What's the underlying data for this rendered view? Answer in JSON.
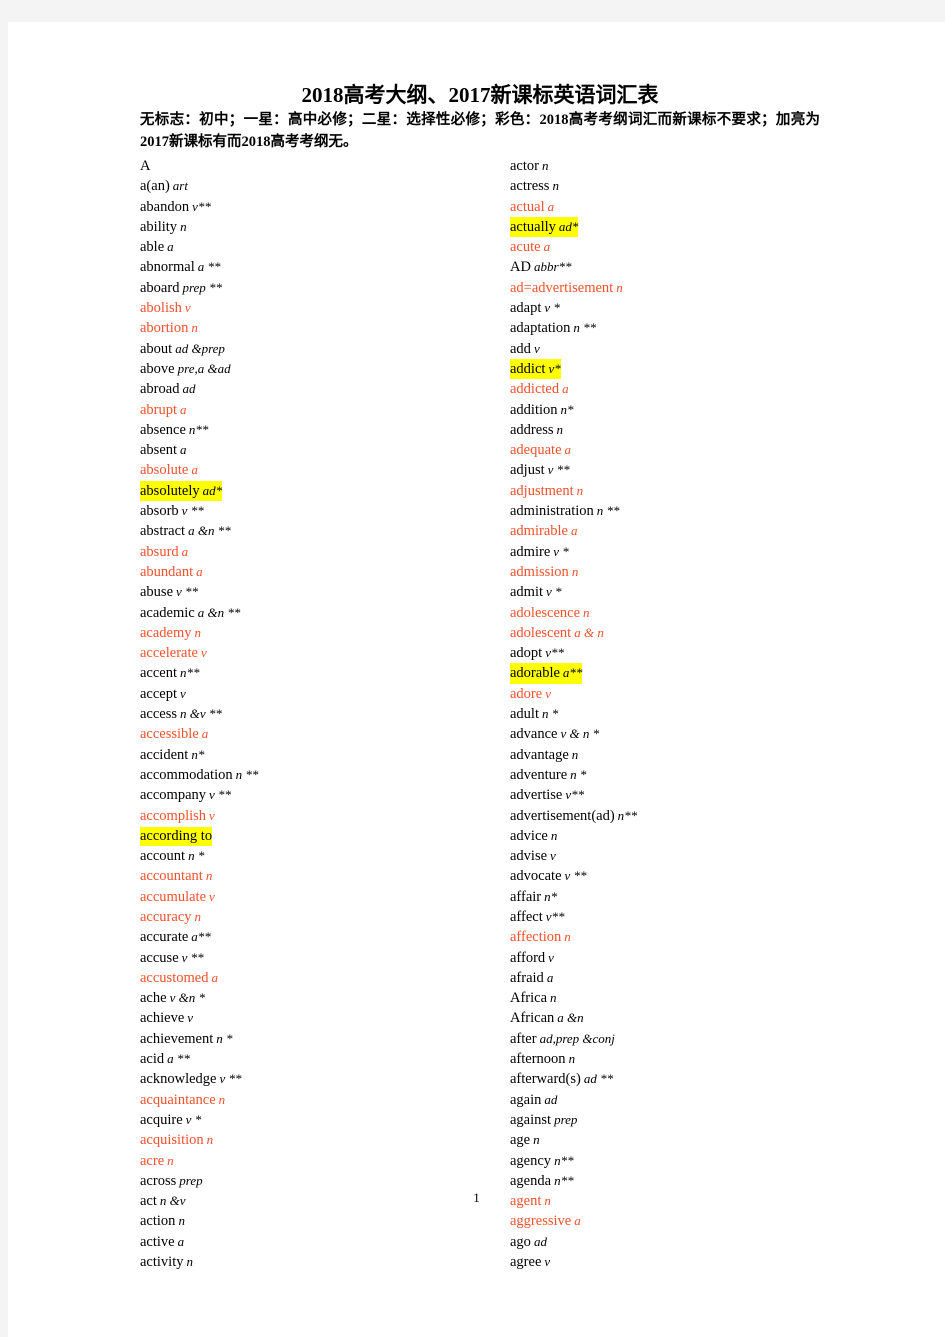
{
  "document": {
    "title": "2018高考大纲、2017新课标英语词汇表",
    "subtitle": "无标志：初中；一星：高中必修；二星：选择性必修；彩色：2018高考考纲词汇而新课标不要求；加亮为2017新课标有而2018高考考纲无。",
    "page_number": "1",
    "colors": {
      "red_entry": "#f4512c",
      "highlight": "#ffff00",
      "text": "#000000",
      "page_background": "#ffffff",
      "canvas_background": "#f4f4f4"
    }
  },
  "legend": {
    "no_mark": "初中",
    "one_star": "高中必修",
    "two_star": "选择性必修",
    "colored": "2018高考考纲词汇而新课标不要求",
    "highlighted": "2017新课标有而2018高考考纲无"
  },
  "columns": [
    {
      "id": "left",
      "entries": [
        {
          "word": "A",
          "pos": "",
          "style": "plain"
        },
        {
          "word": "a(an)",
          "pos": "art",
          "style": "plain"
        },
        {
          "word": "abandon",
          "pos": "v**",
          "style": "plain"
        },
        {
          "word": "ability",
          "pos": "n",
          "style": "plain"
        },
        {
          "word": "able",
          "pos": "a",
          "style": "plain"
        },
        {
          "word": "abnormal",
          "pos": "a **",
          "style": "plain"
        },
        {
          "word": "aboard",
          "pos": "prep **",
          "style": "plain"
        },
        {
          "word": "abolish",
          "pos": "v",
          "style": "red"
        },
        {
          "word": "abortion",
          "pos": "n",
          "style": "red"
        },
        {
          "word": "about",
          "pos": "ad &prep",
          "style": "plain"
        },
        {
          "word": "above",
          "pos": "pre,a &ad",
          "style": "plain"
        },
        {
          "word": "abroad",
          "pos": "ad",
          "style": "plain"
        },
        {
          "word": "abrupt",
          "pos": "a",
          "style": "red"
        },
        {
          "word": "absence",
          "pos": "n**",
          "style": "plain"
        },
        {
          "word": "absent",
          "pos": "a",
          "style": "plain"
        },
        {
          "word": "absolute",
          "pos": "a",
          "style": "red"
        },
        {
          "word": "absolutely",
          "pos": "ad*",
          "style": "highlight"
        },
        {
          "word": "absorb",
          "pos": "v **",
          "style": "plain"
        },
        {
          "word": "abstract",
          "pos": "a &n **",
          "style": "plain"
        },
        {
          "word": "absurd",
          "pos": "a",
          "style": "red"
        },
        {
          "word": "abundant",
          "pos": "a",
          "style": "red"
        },
        {
          "word": "abuse",
          "pos": "v **",
          "style": "plain"
        },
        {
          "word": "academic",
          "pos": "a &n **",
          "style": "plain"
        },
        {
          "word": "academy",
          "pos": "n",
          "style": "red"
        },
        {
          "word": "accelerate",
          "pos": "v",
          "style": "red"
        },
        {
          "word": "accent",
          "pos": "n**",
          "style": "plain"
        },
        {
          "word": "accept",
          "pos": "v",
          "style": "plain"
        },
        {
          "word": "access",
          "pos": "n &v **",
          "style": "plain"
        },
        {
          "word": "accessible",
          "pos": "a",
          "style": "red"
        },
        {
          "word": "accident",
          "pos": "n*",
          "style": "plain"
        },
        {
          "word": "accommodation",
          "pos": "n **",
          "style": "plain"
        },
        {
          "word": "accompany",
          "pos": "v **",
          "style": "plain"
        },
        {
          "word": "accomplish",
          "pos": "v",
          "style": "red"
        },
        {
          "word": "according to",
          "pos": "",
          "style": "highlight"
        },
        {
          "word": "account",
          "pos": "n *",
          "style": "plain"
        },
        {
          "word": "accountant",
          "pos": "n",
          "style": "red"
        },
        {
          "word": "accumulate",
          "pos": "v",
          "style": "red"
        },
        {
          "word": "accuracy",
          "pos": "n",
          "style": "red"
        },
        {
          "word": "accurate",
          "pos": "a**",
          "style": "plain"
        },
        {
          "word": "accuse",
          "pos": "v **",
          "style": "plain"
        },
        {
          "word": "accustomed",
          "pos": "a",
          "style": "red"
        },
        {
          "word": "ache",
          "pos": "v &n *",
          "style": "plain"
        },
        {
          "word": "achieve",
          "pos": "v",
          "style": "plain"
        },
        {
          "word": "achievement",
          "pos": "n *",
          "style": "plain"
        },
        {
          "word": "acid",
          "pos": "a **",
          "style": "plain"
        },
        {
          "word": "acknowledge",
          "pos": "v **",
          "style": "plain"
        },
        {
          "word": "acquaintance",
          "pos": "n",
          "style": "red"
        },
        {
          "word": "acquire",
          "pos": "v *",
          "style": "plain"
        },
        {
          "word": "acquisition",
          "pos": "n",
          "style": "red"
        },
        {
          "word": "acre",
          "pos": "n",
          "style": "red"
        },
        {
          "word": "across",
          "pos": "prep",
          "style": "plain"
        },
        {
          "word": "act",
          "pos": "n &v",
          "style": "plain"
        },
        {
          "word": "action",
          "pos": "n",
          "style": "plain"
        },
        {
          "word": "active",
          "pos": "a",
          "style": "plain"
        },
        {
          "word": "activity",
          "pos": "n",
          "style": "plain"
        }
      ]
    },
    {
      "id": "right",
      "entries": [
        {
          "word": "actor",
          "pos": "n",
          "style": "plain"
        },
        {
          "word": "actress",
          "pos": "n",
          "style": "plain"
        },
        {
          "word": "actual",
          "pos": "a",
          "style": "red"
        },
        {
          "word": "actually",
          "pos": "ad*",
          "style": "highlight"
        },
        {
          "word": "acute",
          "pos": "a",
          "style": "red"
        },
        {
          "word": "AD",
          "pos": "abbr**",
          "style": "plain"
        },
        {
          "word": "ad=advertisement",
          "pos": "n",
          "style": "red"
        },
        {
          "word": "adapt",
          "pos": "v *",
          "style": "plain"
        },
        {
          "word": "adaptation",
          "pos": "n **",
          "style": "plain"
        },
        {
          "word": "add",
          "pos": "v",
          "style": "plain"
        },
        {
          "word": "addict",
          "pos": "v*",
          "style": "highlight"
        },
        {
          "word": "addicted",
          "pos": "a",
          "style": "red"
        },
        {
          "word": "addition",
          "pos": "n*",
          "style": "plain"
        },
        {
          "word": "address",
          "pos": "n",
          "style": "plain"
        },
        {
          "word": "adequate",
          "pos": "a",
          "style": "red"
        },
        {
          "word": "adjust",
          "pos": "v **",
          "style": "plain"
        },
        {
          "word": "adjustment",
          "pos": "n",
          "style": "red"
        },
        {
          "word": "administration",
          "pos": "n **",
          "style": "plain"
        },
        {
          "word": "admirable",
          "pos": "a",
          "style": "red"
        },
        {
          "word": "admire",
          "pos": "v *",
          "style": "plain"
        },
        {
          "word": "admission",
          "pos": "n",
          "style": "red"
        },
        {
          "word": "admit",
          "pos": "v *",
          "style": "plain"
        },
        {
          "word": "adolescence",
          "pos": "n",
          "style": "red"
        },
        {
          "word": "adolescent",
          "pos": "a & n",
          "style": "red"
        },
        {
          "word": "adopt",
          "pos": "v**",
          "style": "plain"
        },
        {
          "word": "adorable",
          "pos": "a**",
          "style": "highlight"
        },
        {
          "word": "adore",
          "pos": "v",
          "style": "red"
        },
        {
          "word": "adult",
          "pos": "n *",
          "style": "plain"
        },
        {
          "word": "advance",
          "pos": "v & n *",
          "style": "plain"
        },
        {
          "word": "advantage",
          "pos": "n",
          "style": "plain"
        },
        {
          "word": "adventure",
          "pos": "n *",
          "style": "plain"
        },
        {
          "word": "advertise",
          "pos": "v**",
          "style": "plain"
        },
        {
          "word": "advertisement(ad)",
          "pos": "n**",
          "style": "plain"
        },
        {
          "word": "advice",
          "pos": "n",
          "style": "plain"
        },
        {
          "word": "advise",
          "pos": "v",
          "style": "plain"
        },
        {
          "word": "advocate",
          "pos": "v **",
          "style": "plain"
        },
        {
          "word": "affair",
          "pos": "n*",
          "style": "plain"
        },
        {
          "word": "affect",
          "pos": "v**",
          "style": "plain"
        },
        {
          "word": "affection",
          "pos": "n",
          "style": "red"
        },
        {
          "word": "afford",
          "pos": "v",
          "style": "plain"
        },
        {
          "word": "afraid",
          "pos": "a",
          "style": "plain"
        },
        {
          "word": "Africa",
          "pos": "n",
          "style": "plain"
        },
        {
          "word": "African",
          "pos": "a &n",
          "style": "plain"
        },
        {
          "word": "after",
          "pos": "ad,prep &conj",
          "style": "plain"
        },
        {
          "word": "afternoon",
          "pos": "n",
          "style": "plain"
        },
        {
          "word": "afterward(s)",
          "pos": "ad **",
          "style": "plain"
        },
        {
          "word": "again",
          "pos": "ad",
          "style": "plain"
        },
        {
          "word": "against",
          "pos": "prep",
          "style": "plain"
        },
        {
          "word": "age",
          "pos": "n",
          "style": "plain"
        },
        {
          "word": "agency",
          "pos": "n**",
          "style": "plain"
        },
        {
          "word": "agenda",
          "pos": "n**",
          "style": "plain"
        },
        {
          "word": "agent",
          "pos": "n",
          "style": "red"
        },
        {
          "word": "aggressive",
          "pos": "a",
          "style": "red"
        },
        {
          "word": "ago",
          "pos": "ad",
          "style": "plain"
        },
        {
          "word": "agree",
          "pos": "v",
          "style": "plain"
        }
      ]
    }
  ]
}
